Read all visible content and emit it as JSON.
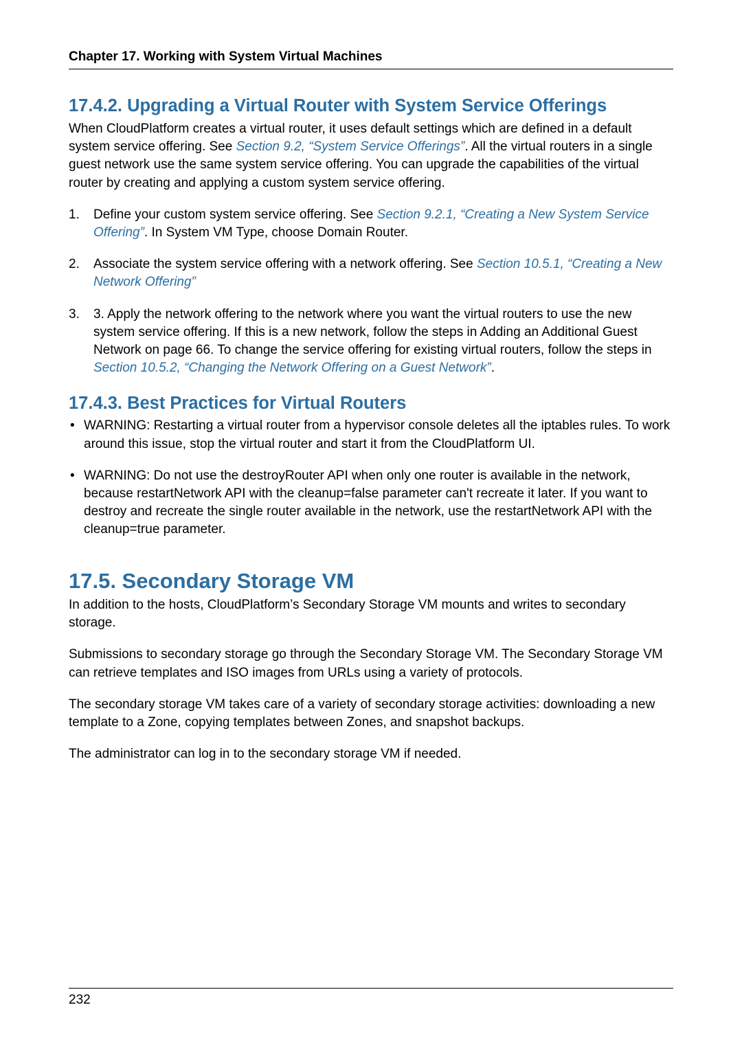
{
  "runningHead": "Chapter 17. Working with System Virtual Machines",
  "pageNumber": "232",
  "sec1742": {
    "title": "17.4.2. Upgrading a Virtual Router with System Service Offerings",
    "intro_a": "When CloudPlatform creates a virtual router, it uses default settings which are defined in a default system service offering. See ",
    "intro_link": "Section 9.2, “System Service Offerings”",
    "intro_b": ". All the virtual routers in a single guest network use the same system service offering. You can upgrade the capabilities of the virtual router by creating and applying a custom system service offering.",
    "step1_a": "Define your custom system service offering. See ",
    "step1_link": "Section 9.2.1, “Creating a New System Service Offering”",
    "step1_b": ". In System VM Type, choose Domain Router.",
    "step2_a": "Associate the system service offering with a network offering. See ",
    "step2_link": "Section 10.5.1, “Creating a New Network Offering”",
    "step3_a": "3. Apply the network offering to the network where you want the virtual routers to use the new system service offering. If this is a new network, follow the steps in Adding an Additional Guest Network on page 66. To change the service offering for existing virtual routers, follow the steps in ",
    "step3_link": "Section 10.5.2, “Changing the Network Offering on a Guest Network”",
    "step3_b": "."
  },
  "sec1743": {
    "title": "17.4.3. Best Practices for Virtual Routers",
    "b1": "WARNING: Restarting a virtual router from a hypervisor console deletes all the iptables rules. To work around this issue, stop the virtual router and start it from the CloudPlatform UI.",
    "b2": "WARNING: Do not use the destroyRouter API when only one router is available in the network, because restartNetwork API with the cleanup=false parameter can't recreate it later. If you want to destroy and recreate the single router available in the network, use the restartNetwork API with the cleanup=true parameter."
  },
  "sec175": {
    "title": "17.5. Secondary Storage VM",
    "p1": "In addition to the hosts, CloudPlatform’s Secondary Storage VM mounts and writes to secondary storage.",
    "p2": "Submissions to secondary storage go through the Secondary Storage VM. The Secondary Storage VM can retrieve templates and ISO images from URLs using a variety of protocols.",
    "p3": "The secondary storage VM takes care of a variety of secondary storage activities: downloading a new template to a Zone, copying templates between Zones, and snapshot backups.",
    "p4": "The administrator can log in to the secondary storage VM if needed."
  }
}
